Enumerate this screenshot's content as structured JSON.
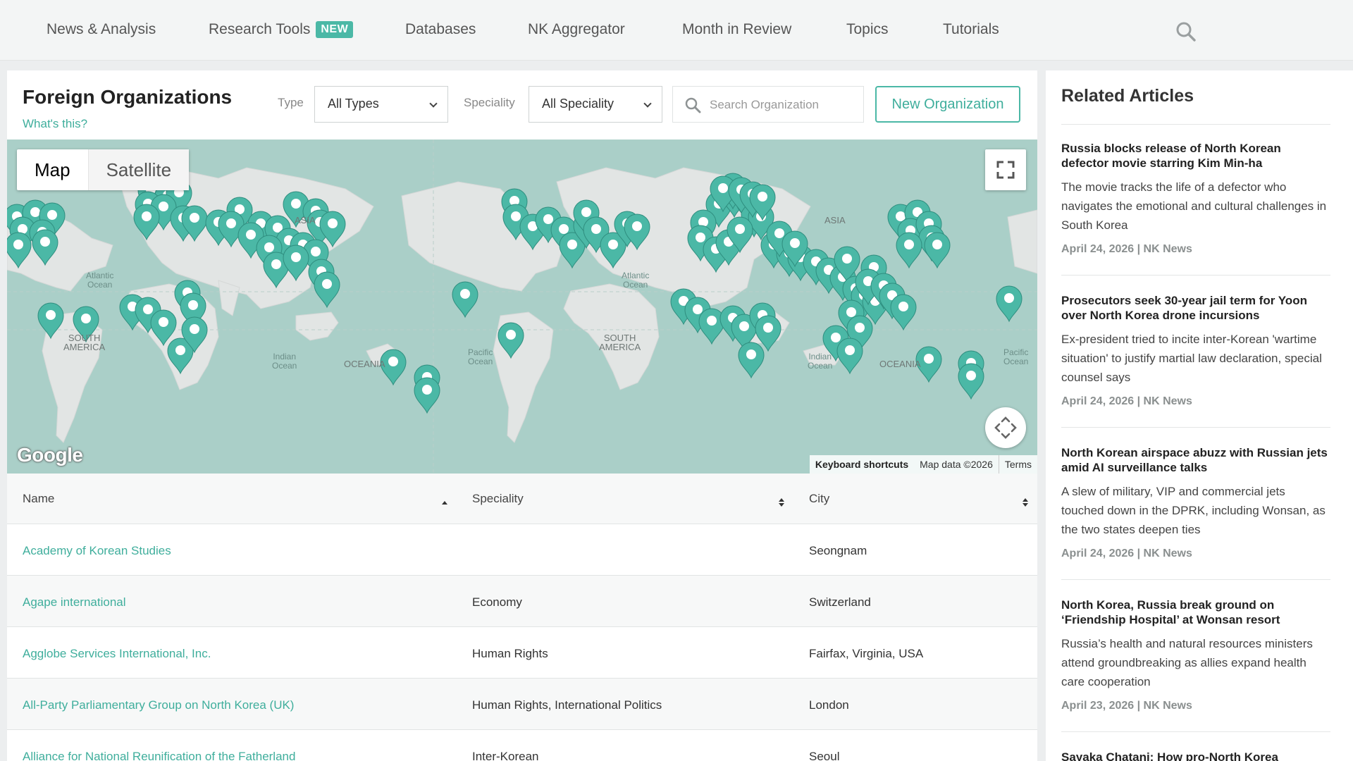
{
  "nav": {
    "items": [
      "News & Analysis",
      "Research Tools",
      "Databases",
      "NK Aggregator",
      "Month in Review",
      "Topics",
      "Tutorials"
    ],
    "badge": "NEW",
    "search_icon": "search-icon"
  },
  "page": {
    "title": "Foreign Organizations",
    "whats_this": "What's this?"
  },
  "filters": {
    "type_label": "Type",
    "type_value": "All Types",
    "speciality_label": "Speciality",
    "speciality_value": "All Speciality",
    "search_placeholder": "Search Organization",
    "new_button": "New Organization"
  },
  "map": {
    "toggle_map": "Map",
    "toggle_satellite": "Satellite",
    "google": "Google",
    "keyboard_shortcuts": "Keyboard shortcuts",
    "map_data": "Map data ©2026",
    "terms": "Terms",
    "labels": {
      "asia": "ASIA",
      "atlantic": "Atlantic\nOcean",
      "south_america": "SOUTH\nAMERICA",
      "indian": "Indian\nOcean",
      "oceania": "OCEANIA",
      "pacific": "Pacific\nOcean"
    },
    "marker_color": "#4bb8a6"
  },
  "table": {
    "headers": {
      "name": "Name",
      "speciality": "Speciality",
      "city": "City"
    },
    "rows": [
      {
        "name": "Academy of Korean Studies",
        "speciality": "",
        "city": "Seongnam"
      },
      {
        "name": "Agape international",
        "speciality": "Economy",
        "city": "Switzerland"
      },
      {
        "name": "Agglobe Services International, Inc.",
        "speciality": "Human Rights",
        "city": "Fairfax, Virginia, USA"
      },
      {
        "name": "All-Party Parliamentary Group on North Korea (UK)",
        "speciality": "Human Rights, International Politics",
        "city": "London"
      },
      {
        "name": "Alliance for National Reunification of the Fatherland",
        "speciality": "Inter-Korean",
        "city": "Seoul"
      }
    ]
  },
  "sidebar": {
    "title": "Related Articles",
    "articles": [
      {
        "title": "Russia blocks release of North Korean defector movie starring Kim Min-ha",
        "desc": "The movie tracks the life of a defector who navigates the emotional and cultural challenges in South Korea",
        "meta": "April 24, 2026 | NK News"
      },
      {
        "title": "Prosecutors seek 30-year jail term for Yoon over North Korea drone incursions",
        "desc": "Ex-president tried to incite inter-Korean 'wartime situation' to justify martial law declaration, special counsel says",
        "meta": "April 24, 2026 | NK News"
      },
      {
        "title": "North Korean airspace abuzz with Russian jets amid AI surveillance talks",
        "desc": "A slew of military, VIP and commercial jets touched down in the DPRK, including Wonsan, as the two states deepen ties",
        "meta": "April 24, 2026 | NK News"
      },
      {
        "title": "North Korea, Russia break ground on ‘Friendship Hospital’ at Wonsan resort",
        "desc": "Russia’s health and natural resources ministers attend groundbreaking as allies expand health care cooperation",
        "meta": "April 23, 2026 | NK News"
      },
      {
        "title": "Sayaka Chatani: How pro-North Korea",
        "desc": "",
        "meta": ""
      }
    ]
  }
}
